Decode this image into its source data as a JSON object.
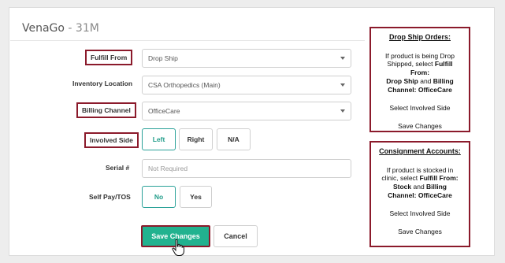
{
  "panel": {
    "title_main": "VenaGo",
    "title_suffix": " - 31M"
  },
  "form": {
    "fulfill_from": {
      "label": "Fulfill From",
      "value": "Drop Ship"
    },
    "inventory_location": {
      "label": "Inventory Location",
      "value": "CSA Orthopedics (Main)"
    },
    "billing_channel": {
      "label": "Billing Channel",
      "value": "OfficeCare"
    },
    "involved_side": {
      "label": "Involved Side",
      "options": [
        "Left",
        "Right",
        "N/A"
      ],
      "selected": "Left"
    },
    "serial": {
      "label": "Serial #",
      "placeholder": "Not Required"
    },
    "self_pay": {
      "label": "Self Pay/TOS",
      "options": [
        "No",
        "Yes"
      ],
      "selected": "No"
    },
    "save_label": "Save Changes",
    "cancel_label": "Cancel"
  },
  "notes": {
    "drop_ship": {
      "title": "Drop Ship Orders:",
      "l1": "If product is being Drop",
      "l2a": "Shipped, select ",
      "l2b": "Fulfill",
      "l3": "From:",
      "l4a": "Drop Ship",
      "l4b": " and ",
      "l4c": "Billing",
      "l5": "Channel: OfficeCare",
      "step1": "Select Involved Side",
      "step2": "Save Changes"
    },
    "consignment": {
      "title": "Consignment Accounts:",
      "l1": "If product is stocked in",
      "l2a": "clinic, select ",
      "l2b": "Fulfill From:",
      "l3a": "Stock",
      "l3b": " and ",
      "l3c": "Billing",
      "l4": "Channel: OfficeCare",
      "step1": "Select Involved Side",
      "step2": "Save Changes"
    }
  },
  "colors": {
    "accent": "#22b28f",
    "highlight_border": "#8b1a2b"
  }
}
